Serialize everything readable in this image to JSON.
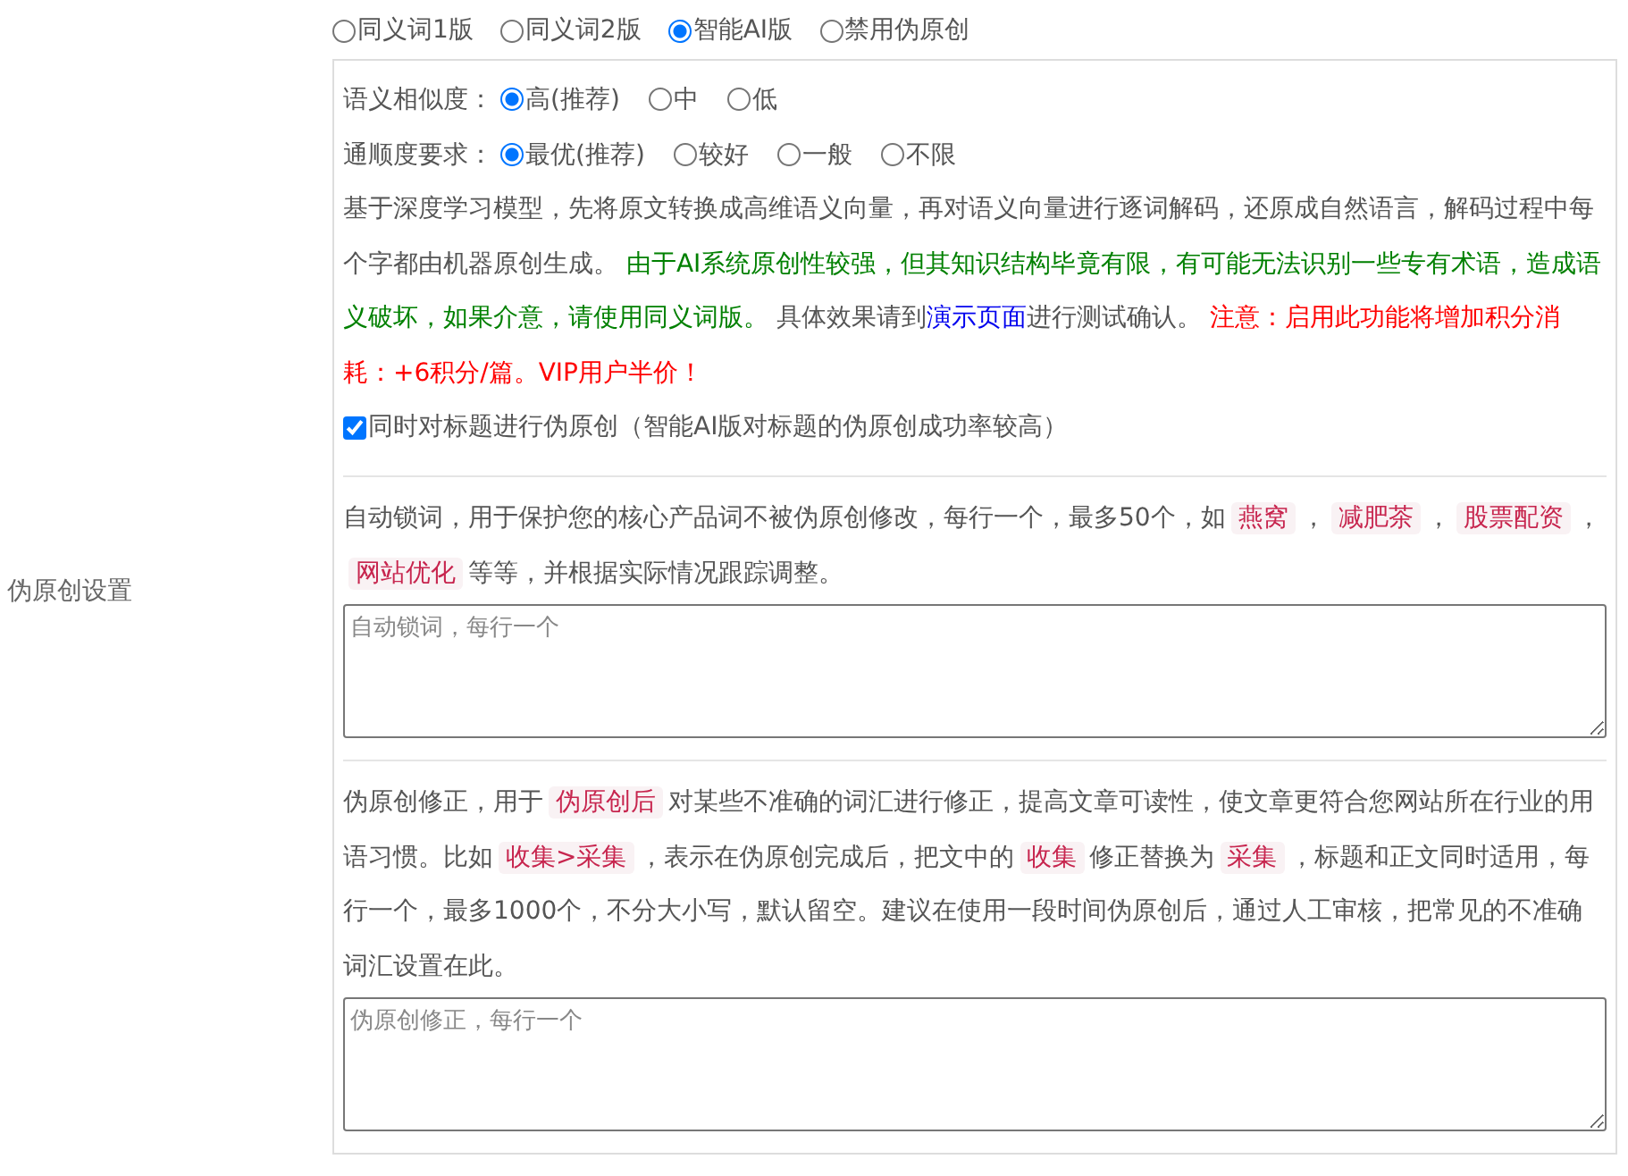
{
  "sidebar_label": "伪原创设置",
  "mode_options": [
    {
      "label": "同义词1版",
      "selected": false
    },
    {
      "label": "同义词2版",
      "selected": false
    },
    {
      "label": "智能AI版",
      "selected": true
    },
    {
      "label": "禁用伪原创",
      "selected": false
    }
  ],
  "ai_settings": {
    "similarity": {
      "label": "语义相似度：",
      "options": [
        {
          "label": "高(推荐)",
          "selected": true
        },
        {
          "label": "中",
          "selected": false
        },
        {
          "label": "低",
          "selected": false
        }
      ]
    },
    "fluency": {
      "label": "通顺度要求：",
      "options": [
        {
          "label": "最优(推荐)",
          "selected": true
        },
        {
          "label": "较好",
          "selected": false
        },
        {
          "label": "一般",
          "selected": false
        },
        {
          "label": "不限",
          "selected": false
        }
      ]
    },
    "description": [
      {
        "kind": "plain",
        "text": "基于深度学习模型，先将原文转换成高维语义向量，再对语义向量进行逐词解码，还原成自然语言，解码过程中每个字都由机器原创生成。 "
      },
      {
        "kind": "note",
        "text": "由于AI系统原创性较强，但其知识结构毕竟有限，有可能无法识别一些专有术语，造成语义破坏，如果介意，请使用同义词版。"
      },
      {
        "kind": "plain",
        "text": " 具体效果请到"
      },
      {
        "kind": "link",
        "text": "演示页面"
      },
      {
        "kind": "plain",
        "text": "进行测试确认。 "
      },
      {
        "kind": "warning",
        "text": "注意：启用此功能将增加积分消耗：+6积分/篇。VIP用户半价！"
      }
    ],
    "title_option": {
      "label": "同时对标题进行伪原创（智能AI版对标题的伪原创成功率较高）",
      "checked": true
    }
  },
  "lock_words": {
    "description": [
      {
        "kind": "plain",
        "text": "自动锁词，用于保护您的核心产品词不被伪原创修改，每行一个，最多50个，如"
      },
      {
        "kind": "tag",
        "text": "燕窝"
      },
      {
        "kind": "plain",
        "text": "，"
      },
      {
        "kind": "tag",
        "text": "减肥茶"
      },
      {
        "kind": "plain",
        "text": "，"
      },
      {
        "kind": "tag",
        "text": "股票配资"
      },
      {
        "kind": "plain",
        "text": "，"
      },
      {
        "kind": "tag",
        "text": "网站优化"
      },
      {
        "kind": "plain",
        "text": "等等，并根据实际情况跟踪调整。"
      }
    ],
    "placeholder": "自动锁词，每行一个"
  },
  "correction": {
    "description": [
      {
        "kind": "plain",
        "text": "伪原创修正，用于"
      },
      {
        "kind": "tag",
        "text": "伪原创后"
      },
      {
        "kind": "plain",
        "text": "对某些不准确的词汇进行修正，提高文章可读性，使文章更符合您网站所在行业的用语习惯。比如"
      },
      {
        "kind": "tag",
        "text": "收集>采集"
      },
      {
        "kind": "plain",
        "text": "，表示在伪原创完成后，把文中的"
      },
      {
        "kind": "tag",
        "text": "收集"
      },
      {
        "kind": "plain",
        "text": "修正替换为"
      },
      {
        "kind": "tag",
        "text": "采集"
      },
      {
        "kind": "plain",
        "text": "，标题和正文同时适用，每行一个，最多1000个，不分大小写，默认留空。建议在使用一段时间伪原创后，通过人工审核，把常见的不准确词汇设置在此。"
      }
    ],
    "placeholder": "伪原创修正，每行一个"
  }
}
